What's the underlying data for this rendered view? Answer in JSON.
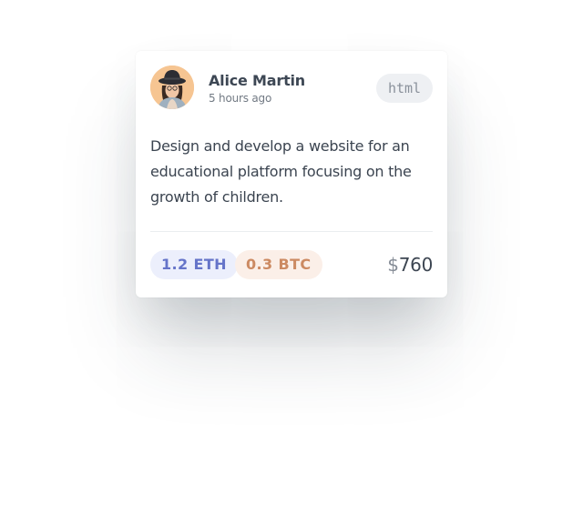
{
  "card": {
    "author": {
      "name": "Alice Martin",
      "time": "5 hours ago",
      "avatar_icon": "user-avatar-woman-hat"
    },
    "language_tag": "html",
    "description": "Design and develop a website for an educational platform focusing on the growth of children.",
    "currencies": [
      {
        "label": "1.2 ETH",
        "color": "#6574c9",
        "background": "#eceffc"
      },
      {
        "label": "0.3 BTC",
        "color": "#cc8a62",
        "background": "#fbefe8"
      }
    ],
    "price": {
      "symbol": "$",
      "amount": "760"
    }
  }
}
